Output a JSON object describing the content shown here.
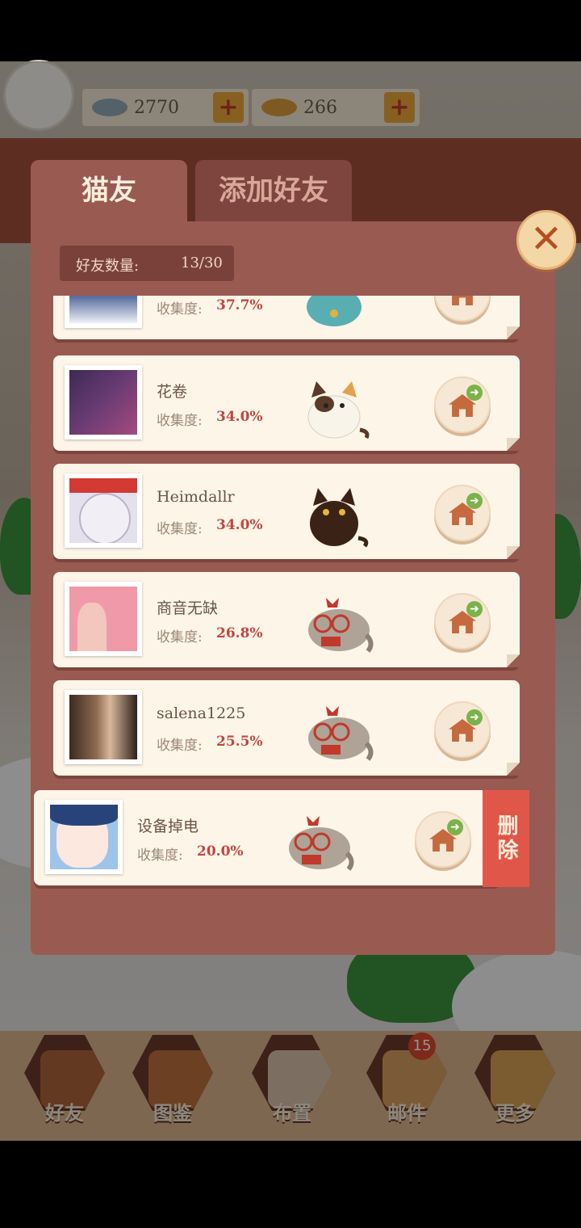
{
  "currency": {
    "fish_silver": "2770",
    "fish_gold": "266"
  },
  "tabs": [
    {
      "label": "猫友"
    },
    {
      "label": "添加好友"
    }
  ],
  "friend_count": {
    "label": "好友数量:",
    "value": "13/30"
  },
  "collection_label": "收集度:",
  "friends": [
    {
      "name": "",
      "collection": "37.7%",
      "cat": "teal-cat-icon"
    },
    {
      "name": "花卷",
      "collection": "34.0%",
      "cat": "calico-cat-icon"
    },
    {
      "name": "Heimdallr",
      "collection": "34.0%",
      "cat": "black-cat-icon"
    },
    {
      "name": "商音无缺",
      "collection": "26.8%",
      "cat": "glasses-cat-icon"
    },
    {
      "name": "salena1225",
      "collection": "25.5%",
      "cat": "glasses-cat-icon"
    },
    {
      "name": "设备掉电",
      "collection": "20.0%",
      "cat": "glasses-cat-icon"
    }
  ],
  "delete_label": "删除",
  "bottom_nav": [
    {
      "label": "好友"
    },
    {
      "label": "图鉴"
    },
    {
      "label": "布置"
    },
    {
      "label": "邮件",
      "badge": "15"
    },
    {
      "label": "更多"
    }
  ],
  "colors": {
    "modal": "#995a52",
    "card": "#fdf5e8",
    "accent": "#c0473f",
    "delete": "#e0574a"
  }
}
